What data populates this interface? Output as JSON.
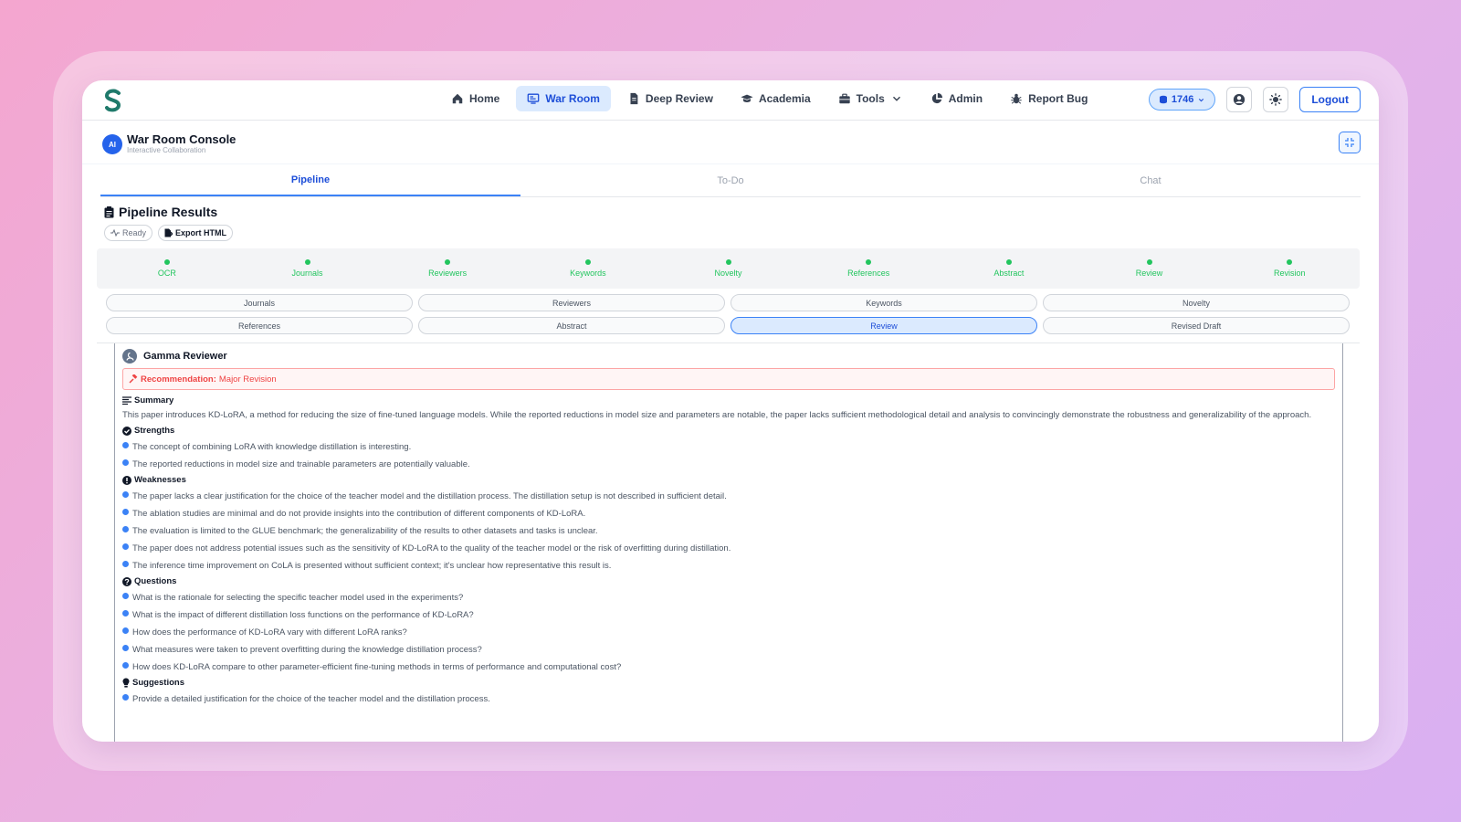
{
  "nav": {
    "links": [
      {
        "label": "Home",
        "icon": "home-icon"
      },
      {
        "label": "War Room",
        "icon": "monitor-icon",
        "active": true
      },
      {
        "label": "Deep Review",
        "icon": "document-icon"
      },
      {
        "label": "Academia",
        "icon": "graduation-cap-icon"
      },
      {
        "label": "Tools",
        "icon": "toolbox-icon"
      },
      {
        "label": "Admin",
        "icon": "pie-chart-icon"
      },
      {
        "label": "Report Bug",
        "icon": "bug-icon"
      }
    ],
    "credits": "1746",
    "logout": "Logout"
  },
  "console": {
    "avatar": "AI",
    "title": "War Room Console",
    "subtitle": "Interactive Collaboration"
  },
  "tabs": [
    {
      "label": "Pipeline",
      "active": true
    },
    {
      "label": "To-Do"
    },
    {
      "label": "Chat"
    }
  ],
  "results": {
    "title": "Pipeline Results",
    "status": "Ready",
    "export": "Export HTML"
  },
  "stages": [
    "OCR",
    "Journals",
    "Reviewers",
    "Keywords",
    "Novelty",
    "References",
    "Abstract",
    "Review",
    "Revision"
  ],
  "subtabs": [
    {
      "label": "Journals"
    },
    {
      "label": "Reviewers"
    },
    {
      "label": "Keywords"
    },
    {
      "label": "Novelty"
    },
    {
      "label": "References"
    },
    {
      "label": "Abstract"
    },
    {
      "label": "Review",
      "active": true
    },
    {
      "label": "Revised Draft"
    }
  ],
  "review": {
    "reviewer": "Gamma Reviewer",
    "rec_label": "Recommendation:",
    "rec_value": "Major Revision",
    "summary_title": "Summary",
    "summary": "This paper introduces KD-LoRA, a method for reducing the size of fine-tuned language models. While the reported reductions in model size and parameters are notable, the paper lacks sufficient methodological detail and analysis to convincingly demonstrate the robustness and generalizability of the approach.",
    "strengths_title": "Strengths",
    "strengths": [
      "The concept of combining LoRA with knowledge distillation is interesting.",
      "The reported reductions in model size and trainable parameters are potentially valuable."
    ],
    "weaknesses_title": "Weaknesses",
    "weaknesses": [
      "The paper lacks a clear justification for the choice of the teacher model and the distillation process. The distillation setup is not described in sufficient detail.",
      "The ablation studies are minimal and do not provide insights into the contribution of different components of KD-LoRA.",
      "The evaluation is limited to the GLUE benchmark; the generalizability of the results to other datasets and tasks is unclear.",
      "The paper does not address potential issues such as the sensitivity of KD-LoRA to the quality of the teacher model or the risk of overfitting during distillation.",
      "The inference time improvement on CoLA is presented without sufficient context; it's unclear how representative this result is."
    ],
    "questions_title": "Questions",
    "questions": [
      "What is the rationale for selecting the specific teacher model used in the experiments?",
      "What is the impact of different distillation loss functions on the performance of KD-LoRA?",
      "How does the performance of KD-LoRA vary with different LoRA ranks?",
      "What measures were taken to prevent overfitting during the knowledge distillation process?",
      "How does KD-LoRA compare to other parameter-efficient fine-tuning methods in terms of performance and computational cost?"
    ],
    "suggestions_title": "Suggestions",
    "suggestions": [
      "Provide a detailed justification for the choice of the teacher model and the distillation process."
    ]
  }
}
